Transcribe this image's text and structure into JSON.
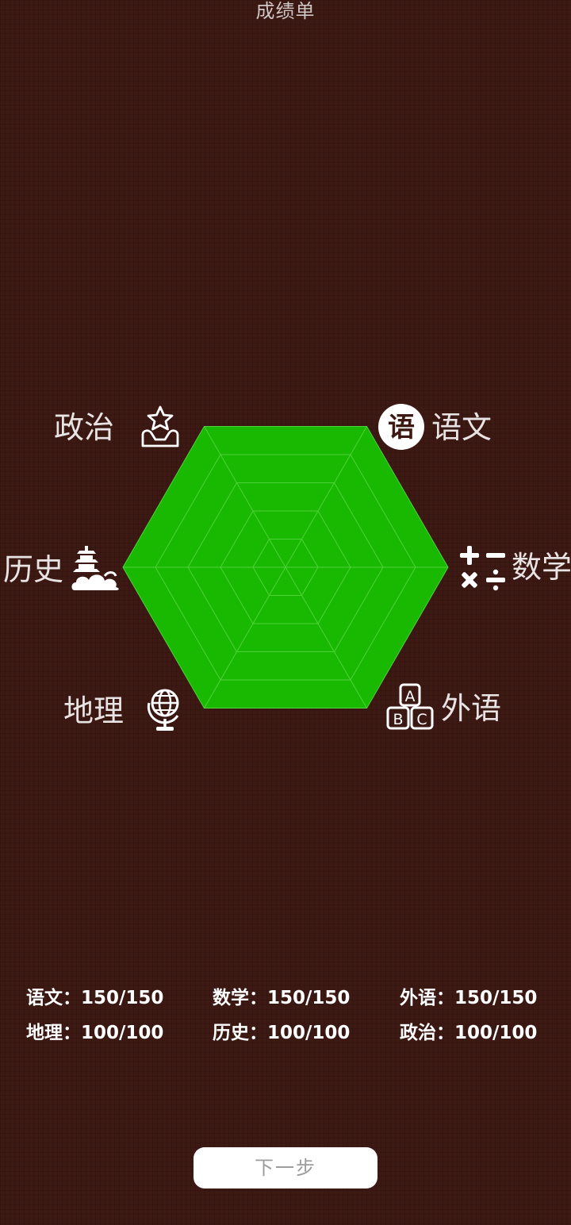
{
  "title": "成绩单",
  "colors": {
    "background": "#3d1914",
    "radar_fill": "#19b902",
    "radar_grid": "#4fd23a",
    "label": "#e8e4e3",
    "button_bg": "#ffffff",
    "button_text": "#9c9c9c"
  },
  "chart_data": {
    "type": "radar",
    "axes": [
      "语文",
      "数学",
      "外语",
      "地理",
      "历史",
      "政治"
    ],
    "values": [
      150,
      150,
      150,
      100,
      100,
      100
    ],
    "max": [
      150,
      150,
      150,
      100,
      100,
      100
    ],
    "normalized": [
      1,
      1,
      1,
      1,
      1,
      1
    ],
    "rings": 5
  },
  "subjects": [
    {
      "label": "语文",
      "icon": "yu-badge-icon"
    },
    {
      "label": "数学",
      "icon": "math-operators-icon"
    },
    {
      "label": "外语",
      "icon": "abc-blocks-icon"
    },
    {
      "label": "地理",
      "icon": "globe-icon"
    },
    {
      "label": "历史",
      "icon": "pagoda-cloud-icon"
    },
    {
      "label": "政治",
      "icon": "star-hands-icon"
    }
  ],
  "scores": {
    "row1": [
      {
        "text": "语文：150/150"
      },
      {
        "text": "数学：150/150"
      },
      {
        "text": "外语：150/150"
      }
    ],
    "row2": [
      {
        "text": "地理：100/100"
      },
      {
        "text": "历史：100/100"
      },
      {
        "text": "政治：100/100"
      }
    ]
  },
  "next_button": {
    "label": "下一步"
  }
}
